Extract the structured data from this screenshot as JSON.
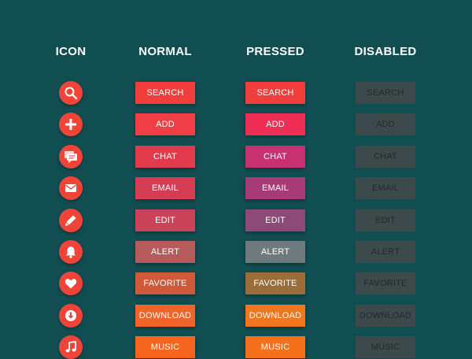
{
  "headers": {
    "icon": "ICON",
    "normal": "NORMAL",
    "pressed": "PRESSED",
    "disabled": "DISABLED"
  },
  "colors": {
    "background": "#114e52",
    "icon": "#f04438",
    "disabled": "#3c4a4b"
  },
  "rows": [
    {
      "label": "SEARCH",
      "icon": "search-icon",
      "normal_color": "#f03e3c",
      "pressed_color": "#f03e3c"
    },
    {
      "label": "ADD",
      "icon": "plus-icon",
      "normal_color": "#ef3e45",
      "pressed_color": "#ee2e55"
    },
    {
      "label": "CHAT",
      "icon": "chat-icon",
      "normal_color": "#e23b4e",
      "pressed_color": "#c8316f"
    },
    {
      "label": "EMAIL",
      "icon": "email-icon",
      "normal_color": "#d63d54",
      "pressed_color": "#a93a78"
    },
    {
      "label": "EDIT",
      "icon": "pencil-icon",
      "normal_color": "#c9435a",
      "pressed_color": "#8c4a76"
    },
    {
      "label": "ALERT",
      "icon": "bell-icon",
      "normal_color": "#b65a5b",
      "pressed_color": "#6f7a7f"
    },
    {
      "label": "FAVORITE",
      "icon": "heart-icon",
      "normal_color": "#cf5a3a",
      "pressed_color": "#9a6d3b"
    },
    {
      "label": "DOWNLOAD",
      "icon": "download-icon",
      "normal_color": "#ef6428",
      "pressed_color": "#f07620"
    },
    {
      "label": "MUSIC",
      "icon": "music-icon",
      "normal_color": "#f5651e",
      "pressed_color": "#f5701a"
    }
  ]
}
